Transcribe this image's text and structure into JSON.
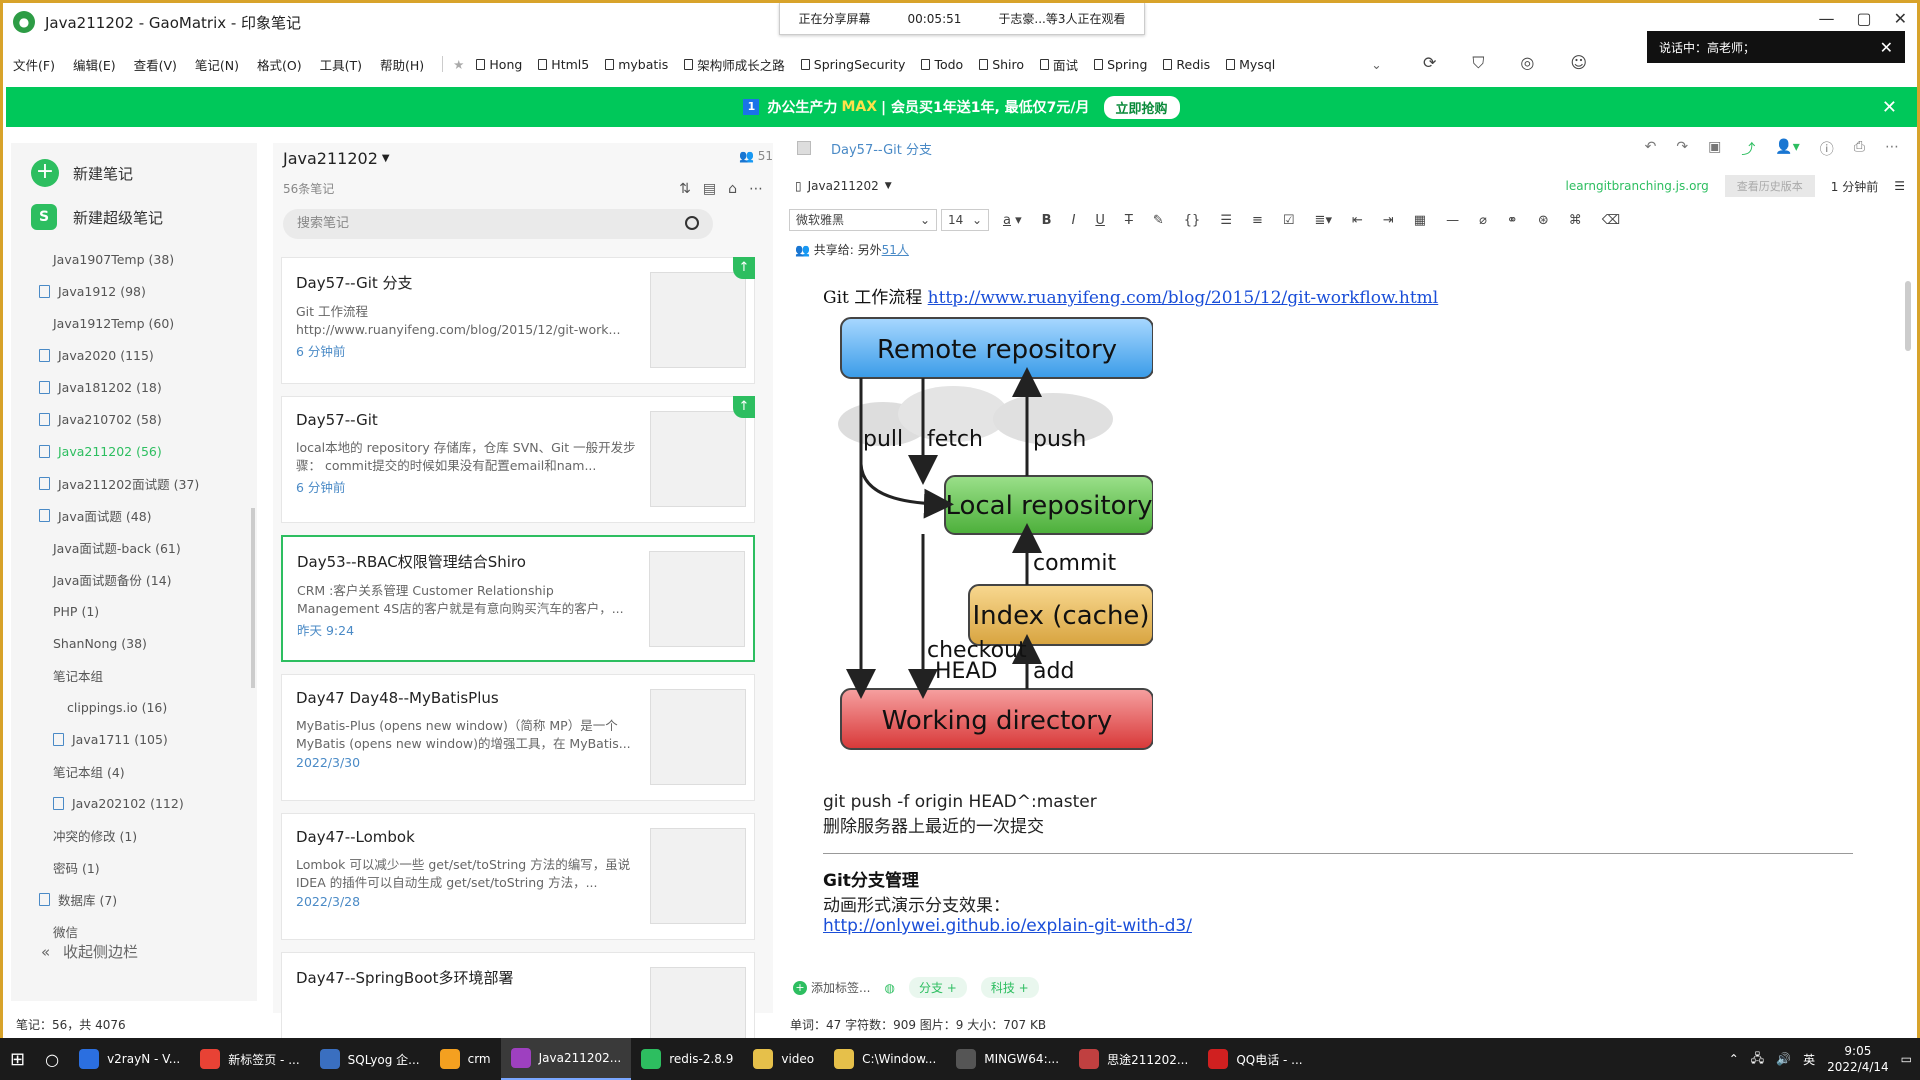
{
  "window": {
    "title": "Java211202 - GaoMatrix - 印象笔记"
  },
  "share_bar": {
    "status": "正在分享屏幕",
    "time": "00:05:51",
    "viewers": "于志豪...等3人正在观看"
  },
  "speaking": {
    "label": "说话中：高老师；"
  },
  "menu": [
    "文件(F)",
    "编辑(E)",
    "查看(V)",
    "笔记(N)",
    "格式(O)",
    "工具(T)",
    "帮助(H)"
  ],
  "shortcuts": [
    "Hong",
    "Html5",
    "mybatis",
    "架构师成长之路",
    "SpringSecurity",
    "Todo",
    "Shiro",
    "面试",
    "Spring",
    "Redis",
    "Mysql"
  ],
  "banner": {
    "num": "1",
    "pre": "办公生产力",
    "max": "MAX",
    "post": "| 会员买1年送1年, 最低仅7元/月",
    "cta": "立即抢购",
    "close": "✕"
  },
  "sidebar": {
    "new_note": "新建笔记",
    "new_super": "新建超级笔记",
    "notebooks": [
      {
        "label": "Java1907Temp  (38)",
        "icon": false,
        "indent": 42
      },
      {
        "label": "Java1912  (98)",
        "icon": true,
        "indent": 28
      },
      {
        "label": "Java1912Temp  (60)",
        "icon": false,
        "indent": 42
      },
      {
        "label": "Java2020  (115)",
        "icon": true,
        "indent": 28
      },
      {
        "label": "Java181202  (18)",
        "icon": true,
        "indent": 28
      },
      {
        "label": "Java210702  (58)",
        "icon": true,
        "indent": 28
      },
      {
        "label": "Java211202  (56)",
        "icon": true,
        "indent": 28,
        "active": true
      },
      {
        "label": "Java211202面试题  (37)",
        "icon": true,
        "indent": 28
      },
      {
        "label": "Java面试题  (48)",
        "icon": true,
        "indent": 28
      },
      {
        "label": "Java面试题-back  (61)",
        "icon": false,
        "indent": 42
      },
      {
        "label": "Java面试题备份  (14)",
        "icon": false,
        "indent": 42
      },
      {
        "label": "PHP  (1)",
        "icon": false,
        "indent": 42
      },
      {
        "label": "ShanNong  (38)",
        "icon": false,
        "indent": 42
      },
      {
        "label": "笔记本组",
        "icon": false,
        "indent": 42
      },
      {
        "label": "clippings.io  (16)",
        "icon": false,
        "indent": 56
      },
      {
        "label": "Java1711  (105)",
        "icon": true,
        "indent": 42
      },
      {
        "label": "笔记本组 (4)",
        "icon": false,
        "indent": 42
      },
      {
        "label": "Java202102  (112)",
        "icon": true,
        "indent": 42
      },
      {
        "label": "冲突的修改  (1)",
        "icon": false,
        "indent": 42
      },
      {
        "label": "密码  (1)",
        "icon": false,
        "indent": 42
      },
      {
        "label": "数据库  (7)",
        "icon": true,
        "indent": 28
      },
      {
        "label": "微信",
        "icon": false,
        "indent": 42
      }
    ],
    "collapse": "收起侧边栏"
  },
  "list": {
    "notebook": "Java211202",
    "count": "56条笔记",
    "users": "51",
    "search_placeholder": "搜索笔记",
    "notes": [
      {
        "title": "Day57--Git 分支",
        "snippet": "Git 工作流程 http://www.ruanyifeng.com/blog/2015/12/git-work...",
        "date": "6 分钟前",
        "pinned": true
      },
      {
        "title": "Day57--Git",
        "snippet": "local本地的 repository 存储库，仓库 SVN、Git 一般开发步骤： commit提交的时候如果没有配置email和nam...",
        "date": "6 分钟前",
        "pinned": true
      },
      {
        "title": "Day53--RBAC权限管理结合Shiro",
        "snippet": "CRM :客户关系管理 Customer Relationship Management 4S店的客户就是有意向购买汽车的客户，...",
        "date": "昨天 9:24",
        "selected": true
      },
      {
        "title": "Day47 Day48--MyBatisPlus",
        "snippet": "MyBatis-Plus (opens new window)（简称 MP）是一个 MyBatis (opens new window)的增强工具，在 MyBatis...",
        "date": "2022/3/30"
      },
      {
        "title": "Day47--Lombok",
        "snippet": "Lombok 可以减少一些 get/set/toString 方法的编写，虽说 IDEA 的插件可以自动生成 get/set/toString 方法，...",
        "date": "2022/3/28"
      },
      {
        "title": "Day47--SpringBoot多环境部署",
        "snippet": "",
        "date": ""
      }
    ]
  },
  "editor": {
    "note_title": "Day57--Git 分支",
    "notebook": "Java211202",
    "source": "learngitbranching.js.org",
    "history": "查看历史版本",
    "time": "1 分钟前",
    "font": "微软雅黑",
    "size": "14",
    "shared_label": "共享给: 另外",
    "shared_count": "51人",
    "line1_text": "Git 工作流程 ",
    "line1_link": "http://www.ruanyifeng.com/blog/2015/12/git-workflow.html",
    "diagram": {
      "remote": "Remote repository",
      "local": "Local repository",
      "index": "Index (cache)",
      "working": "Working directory",
      "pull": "pull",
      "fetch": "fetch",
      "push": "push",
      "commit": "commit",
      "add": "add",
      "checkout": "checkout",
      "head": "HEAD"
    },
    "cmd": "git push -f origin HEAD^:master",
    "cmd_desc": "删除服务器上最近的一次提交",
    "heading": "Git分支管理",
    "anim_desc": "动画形式演示分支效果：",
    "anim_link": "http://onlywei.github.io/explain-git-with-d3/",
    "tags": {
      "add": "添加标签...",
      "t1": "分支",
      "t2": "科技"
    }
  },
  "status": {
    "left": "笔记：56，共 4076",
    "stats": "单词：47   字符数：909   图片：9   大小：707 KB"
  },
  "taskbar": {
    "items": [
      "v2rayN - V...",
      "新标签页 - ...",
      "SQLyog 企...",
      "crm",
      "Java211202...",
      "redis-2.8.9",
      "video",
      "C:\\Window...",
      "MINGW64:...",
      "思途211202...",
      "QQ电话 - ..."
    ],
    "lang": "英",
    "time": "9:05",
    "date": "2022/4/14"
  },
  "colors": {
    "brand": "#2dbe60",
    "banner": "#00c85a",
    "link": "#1a4ed8"
  }
}
